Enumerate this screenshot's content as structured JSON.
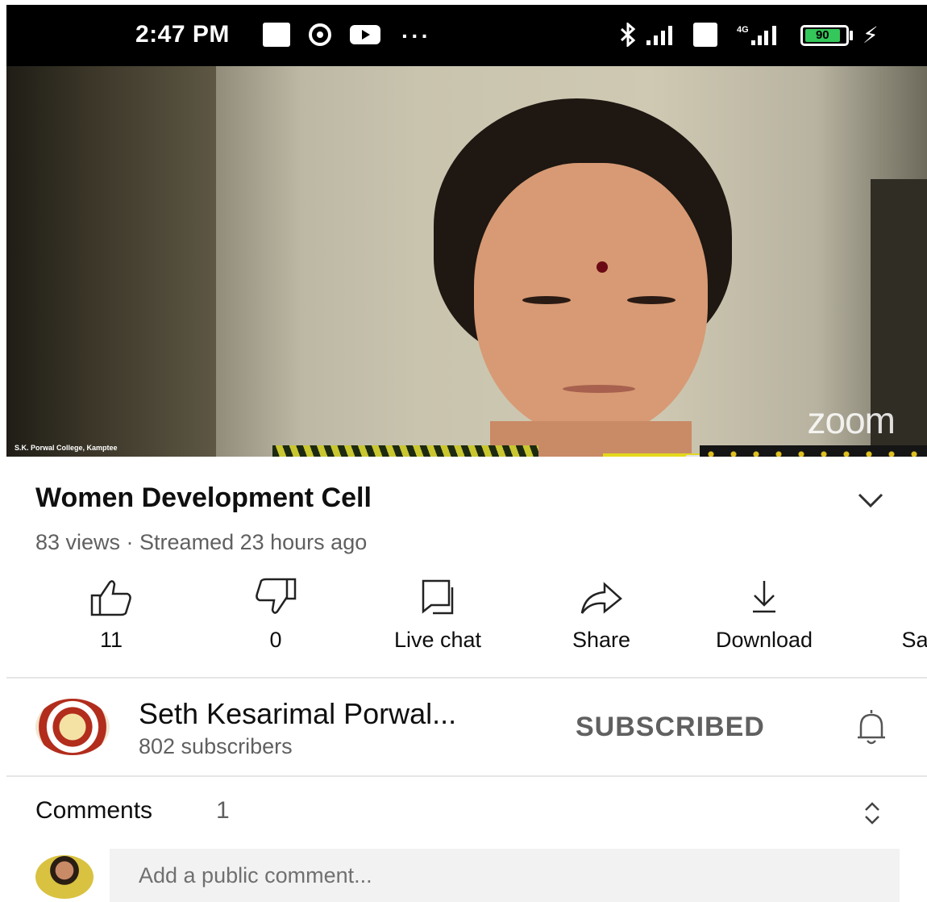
{
  "status_bar": {
    "time": "2:47 PM",
    "more": "···",
    "battery_level": "90",
    "icons": [
      "usb-icon",
      "sync-icon",
      "youtube-icon",
      "bluetooth-icon",
      "signal-icon",
      "volte-icon",
      "lte-signal-icon",
      "battery-icon",
      "charging-icon"
    ]
  },
  "video": {
    "watermark": "S.K. Porwal College, Kamptee",
    "overlay_brand": "zoom"
  },
  "video_info": {
    "title": "Women Development Cell",
    "meta": "83 views · Streamed 23 hours ago"
  },
  "actions": [
    {
      "label": "11",
      "icon": "thumbs-up-icon"
    },
    {
      "label": "0",
      "icon": "thumbs-down-icon"
    },
    {
      "label": "Live chat",
      "icon": "live-chat-icon"
    },
    {
      "label": "Share",
      "icon": "share-icon"
    },
    {
      "label": "Download",
      "icon": "download-icon"
    },
    {
      "label": "Sa",
      "icon": "save-icon"
    }
  ],
  "channel": {
    "name": "Seth Kesarimal Porwal...",
    "subscribers": "802 subscribers",
    "subscribe_label": "SUBSCRIBED"
  },
  "comments": {
    "label": "Comments",
    "count": "1",
    "placeholder": "Add a public comment..."
  },
  "colors": {
    "status_bar_bg": "#000000",
    "secondary_text": "#606060",
    "battery": "#34c759"
  }
}
